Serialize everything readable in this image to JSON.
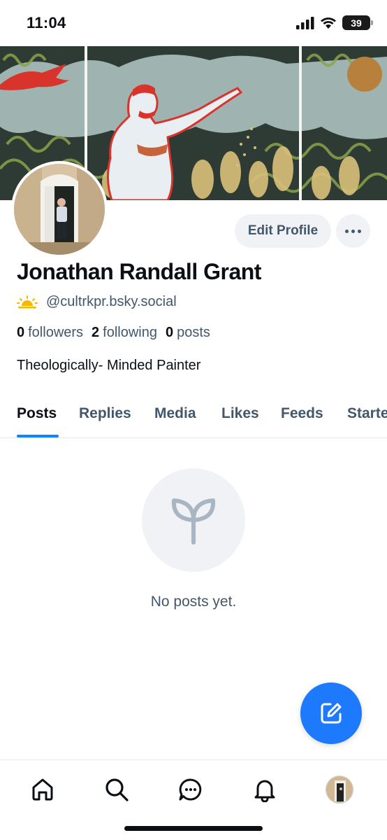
{
  "status_bar": {
    "time": "11:04",
    "battery": "39",
    "icons": [
      "signal-icon",
      "wifi-icon",
      "battery-icon"
    ]
  },
  "profile": {
    "display_name": "Jonathan Randall Grant",
    "handle": "@cultrkpr.bsky.social",
    "handle_icon": "sunrise-emoji-icon",
    "bio": "Theologically- Minded Painter",
    "stats": {
      "followers_count": "0",
      "followers_label": "followers",
      "following_count": "2",
      "following_label": "following",
      "posts_count": "0",
      "posts_label": "posts"
    }
  },
  "actions": {
    "edit_profile_label": "Edit Profile",
    "more_icon": "ellipsis-icon"
  },
  "tabs": [
    {
      "label": "Posts",
      "active": true
    },
    {
      "label": "Replies",
      "active": false
    },
    {
      "label": "Media",
      "active": false
    },
    {
      "label": "Likes",
      "active": false
    },
    {
      "label": "Feeds",
      "active": false
    },
    {
      "label": "Starte",
      "active": false
    }
  ],
  "empty_state": {
    "icon": "sprout-icon",
    "text": "No posts yet."
  },
  "fab": {
    "icon": "compose-icon"
  },
  "bottom_nav": [
    "home-icon",
    "search-icon",
    "chat-icon",
    "bell-icon",
    "profile-avatar"
  ],
  "colors": {
    "accent": "#1083fe",
    "fab": "#1d7afc",
    "muted_text": "#42576c",
    "button_bg": "#f0f2f5"
  }
}
